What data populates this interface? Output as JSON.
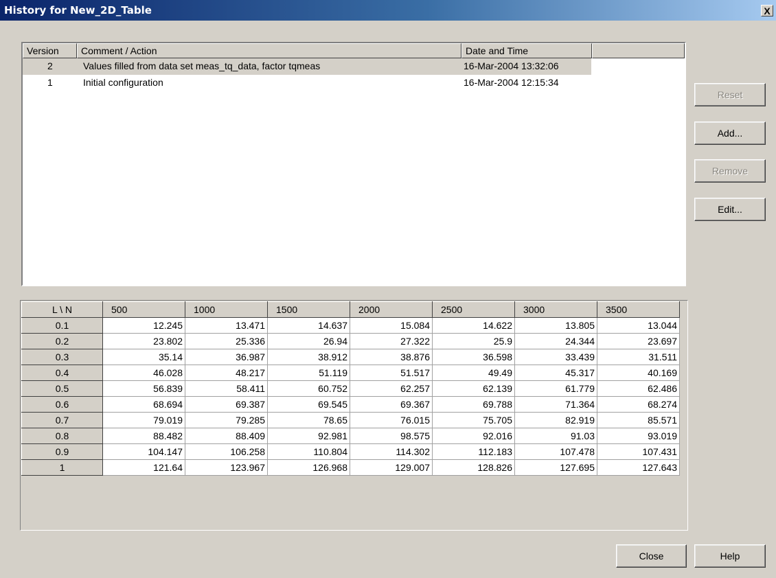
{
  "window": {
    "title": "History for New_2D_Table",
    "close_glyph": "X"
  },
  "history": {
    "columns": [
      "Version",
      "Comment / Action",
      "Date and Time",
      ""
    ],
    "rows": [
      {
        "version": "2",
        "comment": "Values filled from data set meas_tq_data, factor tqmeas",
        "datetime": "16-Mar-2004 13:32:06",
        "selected": true
      },
      {
        "version": "1",
        "comment": "Initial configuration",
        "datetime": "16-Mar-2004 12:15:34",
        "selected": false
      }
    ]
  },
  "side_buttons": {
    "reset": {
      "label": "Reset",
      "enabled": false
    },
    "add": {
      "label": "Add...",
      "enabled": true
    },
    "remove": {
      "label": "Remove",
      "enabled": false
    },
    "edit": {
      "label": "Edit...",
      "enabled": true
    }
  },
  "table": {
    "corner": "L \\ N",
    "columns": [
      "500",
      "1000",
      "1500",
      "2000",
      "2500",
      "3000",
      "3500"
    ],
    "rows": [
      {
        "label": "0.1",
        "values": [
          "12.245",
          "13.471",
          "14.637",
          "15.084",
          "14.622",
          "13.805",
          "13.044"
        ]
      },
      {
        "label": "0.2",
        "values": [
          "23.802",
          "25.336",
          "26.94",
          "27.322",
          "25.9",
          "24.344",
          "23.697"
        ]
      },
      {
        "label": "0.3",
        "values": [
          "35.14",
          "36.987",
          "38.912",
          "38.876",
          "36.598",
          "33.439",
          "31.511"
        ]
      },
      {
        "label": "0.4",
        "values": [
          "46.028",
          "48.217",
          "51.119",
          "51.517",
          "49.49",
          "45.317",
          "40.169"
        ]
      },
      {
        "label": "0.5",
        "values": [
          "56.839",
          "58.411",
          "60.752",
          "62.257",
          "62.139",
          "61.779",
          "62.486"
        ]
      },
      {
        "label": "0.6",
        "values": [
          "68.694",
          "69.387",
          "69.545",
          "69.367",
          "69.788",
          "71.364",
          "68.274"
        ]
      },
      {
        "label": "0.7",
        "values": [
          "79.019",
          "79.285",
          "78.65",
          "76.015",
          "75.705",
          "82.919",
          "85.571"
        ]
      },
      {
        "label": "0.8",
        "values": [
          "88.482",
          "88.409",
          "92.981",
          "98.575",
          "92.016",
          "91.03",
          "93.019"
        ]
      },
      {
        "label": "0.9",
        "values": [
          "104.147",
          "106.258",
          "110.804",
          "114.302",
          "112.183",
          "107.478",
          "107.431"
        ]
      },
      {
        "label": "1",
        "values": [
          "121.64",
          "123.967",
          "126.968",
          "129.007",
          "128.826",
          "127.695",
          "127.643"
        ]
      }
    ]
  },
  "footer": {
    "close_label": "Close",
    "help_label": "Help"
  }
}
